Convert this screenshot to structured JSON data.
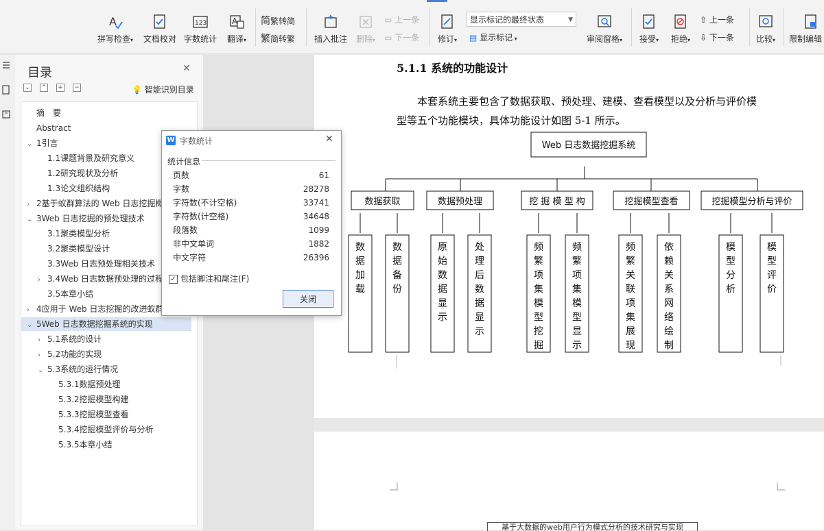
{
  "ribbon": {
    "spellcheck": "拼写检查",
    "doccheck": "文档校对",
    "wordcount": "字数统计",
    "translate": "翻译",
    "t2s": "繁转简",
    "s2t": "简转繁",
    "insert_comment": "插入批注",
    "delete": "删除",
    "prev_comment": "上一条",
    "next_comment": "下一条",
    "revise": "修订",
    "markup_state": "显示标记的最终状态",
    "show_markup": "显示标记",
    "review_pane": "审阅窗格",
    "accept": "接受",
    "reject": "拒绝",
    "prev_change": "上一条",
    "next_change": "下一条",
    "compare": "比较",
    "restrict": "限制编辑"
  },
  "toc": {
    "title": "目录",
    "smart": "智能识别目录",
    "items": [
      {
        "label": "摘　要",
        "level": 0,
        "chev": ""
      },
      {
        "label": "Abstract",
        "level": 0,
        "chev": ""
      },
      {
        "label": "1引言",
        "level": 0,
        "chev": "v"
      },
      {
        "label": "1.1课题背景及研究意义",
        "level": 1,
        "chev": ""
      },
      {
        "label": "1.2研究现状及分析",
        "level": 1,
        "chev": ""
      },
      {
        "label": "1.3论文组织结构",
        "level": 1,
        "chev": ""
      },
      {
        "label": "2基于蚁群算法的 Web 日志挖掘概",
        "level": 0,
        "chev": ">"
      },
      {
        "label": "3Web 日志挖掘的预处理技术",
        "level": 0,
        "chev": "v"
      },
      {
        "label": "3.1聚类模型分析",
        "level": 1,
        "chev": ""
      },
      {
        "label": "3.2聚类模型设计",
        "level": 1,
        "chev": ""
      },
      {
        "label": "3.3Web 日志预处理相关技术",
        "level": 1,
        "chev": ""
      },
      {
        "label": "3.4Web 日志数据预处理的过程",
        "level": 1,
        "chev": ">"
      },
      {
        "label": "3.5本章小结",
        "level": 1,
        "chev": ""
      },
      {
        "label": "4应用于 Web 日志挖掘的改进蚁群",
        "level": 0,
        "chev": ">"
      },
      {
        "label": "5Web 日志数据挖掘系统的实现",
        "level": 0,
        "chev": "v"
      },
      {
        "label": "5.1系统的设计",
        "level": 1,
        "chev": ">"
      },
      {
        "label": "5.2功能的实现",
        "level": 1,
        "chev": ">"
      },
      {
        "label": "5.3系统的运行情况",
        "level": 1,
        "chev": "v"
      },
      {
        "label": "5.3.1数据预处理",
        "level": 2,
        "chev": ""
      },
      {
        "label": "5.3.2挖掘模型构建",
        "level": 2,
        "chev": ""
      },
      {
        "label": "5.3.3挖掘模型查看",
        "level": 2,
        "chev": ""
      },
      {
        "label": "5.3.4挖掘模型评价与分析",
        "level": 2,
        "chev": ""
      },
      {
        "label": "5.3.5本章小结",
        "level": 2,
        "chev": ""
      }
    ]
  },
  "document": {
    "heading": "5.1.1  系统的功能设计",
    "para1": "本套系统主要包含了数据获取、预处理、建模、查看模型以及分析与评价模",
    "para2": "型等五个功能模块，具体功能设计如图 5-1 所示。",
    "diagram": {
      "root": "Web 日志数据挖掘系统",
      "modules": [
        {
          "name": "数据获取",
          "subs": [
            "数据加载",
            "数据备份"
          ]
        },
        {
          "name": "数据预处理",
          "subs": [
            "原始数据显示",
            "处理后数据显示"
          ]
        },
        {
          "name": "挖 掘 模 型 构",
          "subs": [
            "频繁项集模型挖掘",
            "频繁项集模型显示"
          ]
        },
        {
          "name": "挖掘模型查看",
          "subs": [
            "频繁关联项集展现",
            "依赖关系网络绘制"
          ]
        },
        {
          "name": "挖掘模型分析与评价",
          "subs": [
            "模型分析",
            "模型评价"
          ]
        }
      ]
    },
    "footer_text": "基于大数据的web用户行为模式分析的技术研究与实现"
  },
  "dialog": {
    "title": "字数统计",
    "group": "统计信息",
    "rows": [
      {
        "label": "页数",
        "value": "61"
      },
      {
        "label": "字数",
        "value": "28278"
      },
      {
        "label": "字符数(不计空格)",
        "value": "33741"
      },
      {
        "label": "字符数(计空格)",
        "value": "34648"
      },
      {
        "label": "段落数",
        "value": "1099"
      },
      {
        "label": "非中文单词",
        "value": "1882"
      },
      {
        "label": "中文字符",
        "value": "26396"
      }
    ],
    "include_label": "包括脚注和尾注(F)",
    "close_label": "关闭"
  }
}
